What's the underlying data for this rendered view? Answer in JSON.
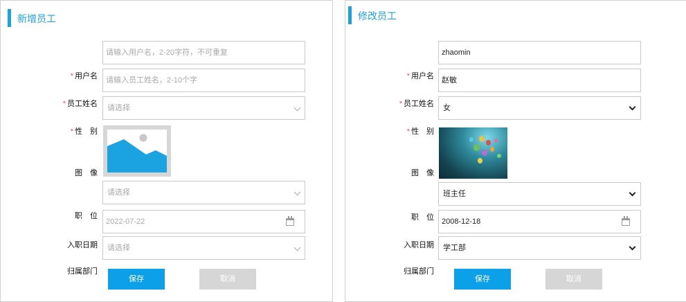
{
  "add_form": {
    "title": "新增员工",
    "fields": {
      "username": {
        "label": "用户名",
        "required": "*",
        "placeholder": "请输入用户名，2-20字符，不可重复"
      },
      "realname": {
        "label": "员工姓名",
        "required": "*",
        "placeholder": "请输入员工姓名，2-10个字"
      },
      "gender": {
        "label": "性　别",
        "required": "*",
        "value": "请选择"
      },
      "image": {
        "label": "图　像",
        "icon": "image-placeholder-icon"
      },
      "position": {
        "label": "职　位",
        "value": "请选择"
      },
      "hire_date": {
        "label": "入职日期",
        "value": "2022-07-22",
        "icon": "calendar-icon"
      },
      "department": {
        "label": "归属部门",
        "value": "请选择"
      }
    },
    "save_label": "保存",
    "cancel_label": "取消"
  },
  "edit_form": {
    "title": "修改员工",
    "fields": {
      "username": {
        "label": "用户名",
        "required": "*",
        "value": "zhaomin"
      },
      "realname": {
        "label": "员工姓名",
        "required": "*",
        "value": "赵敏"
      },
      "gender": {
        "label": "性　别",
        "required": "*",
        "value": "女"
      },
      "image": {
        "label": "图　像"
      },
      "position": {
        "label": "职　位",
        "value": "班主任"
      },
      "hire_date": {
        "label": "入职日期",
        "value": "2008-12-18",
        "icon": "calendar-icon"
      },
      "department": {
        "label": "归属部门",
        "value": "学工部"
      }
    },
    "save_label": "保存",
    "cancel_label": "取消"
  },
  "colors": {
    "accent": "#1aa3e0",
    "save_button": "#0ba0e8",
    "cancel_button": "#d6d6d6",
    "required_mark": "#e05555"
  }
}
